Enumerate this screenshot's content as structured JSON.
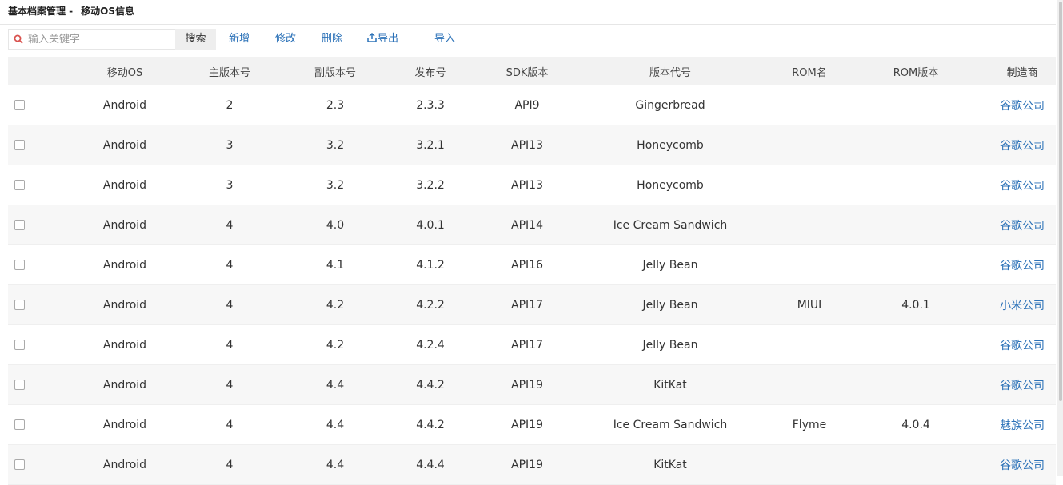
{
  "title": {
    "section": "基本档案管理 -",
    "page": "移动OS信息"
  },
  "toolbar": {
    "search_placeholder": "输入关键字",
    "search_label": "搜索",
    "add_label": "新增",
    "edit_label": "修改",
    "delete_label": "删除",
    "export_label": "导出",
    "import_label": "导入"
  },
  "table": {
    "headers": [
      "移动OS",
      "主版本号",
      "副版本号",
      "发布号",
      "SDK版本",
      "版本代号",
      "ROM名",
      "ROM版本",
      "制造商"
    ],
    "rows": [
      [
        "Android",
        "2",
        "2.3",
        "2.3.3",
        "API9",
        "Gingerbread",
        "",
        "",
        "谷歌公司"
      ],
      [
        "Android",
        "3",
        "3.2",
        "3.2.1",
        "API13",
        "Honeycomb",
        "",
        "",
        "谷歌公司"
      ],
      [
        "Android",
        "3",
        "3.2",
        "3.2.2",
        "API13",
        "Honeycomb",
        "",
        "",
        "谷歌公司"
      ],
      [
        "Android",
        "4",
        "4.0",
        "4.0.1",
        "API14",
        "Ice Cream Sandwich",
        "",
        "",
        "谷歌公司"
      ],
      [
        "Android",
        "4",
        "4.1",
        "4.1.2",
        "API16",
        "Jelly Bean",
        "",
        "",
        "谷歌公司"
      ],
      [
        "Android",
        "4",
        "4.2",
        "4.2.2",
        "API17",
        "Jelly Bean",
        "MIUI",
        "4.0.1",
        "小米公司"
      ],
      [
        "Android",
        "4",
        "4.2",
        "4.2.4",
        "API17",
        "Jelly Bean",
        "",
        "",
        "谷歌公司"
      ],
      [
        "Android",
        "4",
        "4.4",
        "4.4.2",
        "API19",
        "KitKat",
        "",
        "",
        "谷歌公司"
      ],
      [
        "Android",
        "4",
        "4.4",
        "4.4.2",
        "API19",
        "Ice Cream Sandwich",
        "Flyme",
        "4.0.4",
        "魅族公司"
      ],
      [
        "Android",
        "4",
        "4.4",
        "4.4.4",
        "API19",
        "KitKat",
        "",
        "",
        "谷歌公司"
      ]
    ]
  },
  "colors": {
    "link": "#2c72b8",
    "search_icon": "#d9534f",
    "header_bg": "#f2f2f2",
    "alt_row_bg": "#f7f7f7"
  },
  "icons": {
    "search": "search-icon",
    "export": "export-icon"
  }
}
